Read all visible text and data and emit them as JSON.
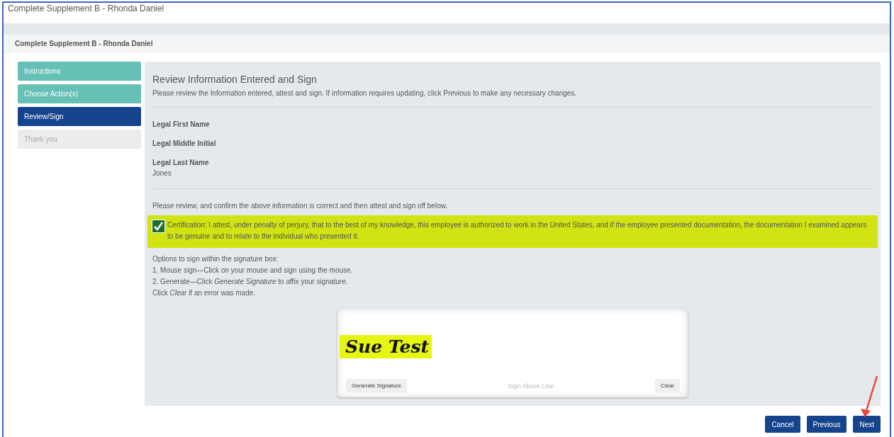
{
  "window": {
    "title": "Complete Supplement B - Rhonda Daniel"
  },
  "header": {
    "title": "Complete Supplement B - Rhonda Daniel"
  },
  "steps": [
    {
      "label": "Instructions",
      "selected": false,
      "completed": true
    },
    {
      "label": "Choose Action(s)",
      "selected": false,
      "completed": true
    },
    {
      "label": "Review/Sign",
      "selected": true
    },
    {
      "label": "Thank you",
      "selected": false,
      "completed": false
    }
  ],
  "panel": {
    "heading": "Review Information Entered and Sign",
    "intro": "Please review the Information entered, attest and sign. If information requires updating, click Previous to make any necessary changes.",
    "fields": [
      {
        "label": "Legal First Name"
      },
      {
        "label": "Legal Middle Initial"
      },
      {
        "label": "Legal Last Name",
        "value": "Jones"
      }
    ],
    "confirm_text": "Please review, and confirm the above information is correct and then attest and sign off below.",
    "certification": {
      "checked": true,
      "text": "Certification: I attest, under penalty of perjury, that to the best of my knowledge, this employee is authorized to work in the United States, and if the employee presented documentation, the documentation I examined appears to be genuine and to relate to the individual who presented it."
    },
    "options": [
      "Options to sign within the signature box:",
      "1. Mouse sign—Click on your mouse and sign using the mouse.",
      "2. Generate—Click *Generate Signature* to affix your signature.",
      "Click *Clear* if an error was made."
    ],
    "signature": {
      "value": "Sue Test",
      "generate_button": "Generate Signature",
      "line_label": "Sign Above Line",
      "clear_button": "Clear"
    }
  },
  "buttons": [
    "Cancel",
    "Previous",
    "Next"
  ]
}
